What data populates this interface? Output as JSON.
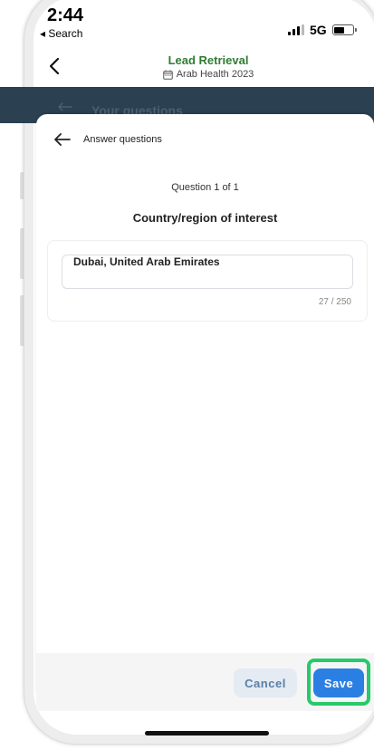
{
  "status_bar": {
    "time": "2:44",
    "back_label": "◂ Search",
    "network": "5G"
  },
  "header": {
    "title": "Lead Retrieval",
    "event_name": "Arab Health 2023",
    "title_color": "#2e7d32"
  },
  "underlying_page": {
    "title": "Your questions"
  },
  "sheet": {
    "title": "Answer questions",
    "question_counter": "Question 1 of 1",
    "question": "Country/region of interest",
    "answer_value": "Dubai, United Arab Emirates",
    "char_count": "27 / 250"
  },
  "actions": {
    "cancel_label": "Cancel",
    "save_label": "Save",
    "save_color": "#2b7fe3",
    "highlight_color": "#27c96a"
  },
  "icons": {
    "back": "arrow-left-icon",
    "calendar": "calendar-icon",
    "signal": "signal-icon",
    "battery": "battery-icon"
  }
}
